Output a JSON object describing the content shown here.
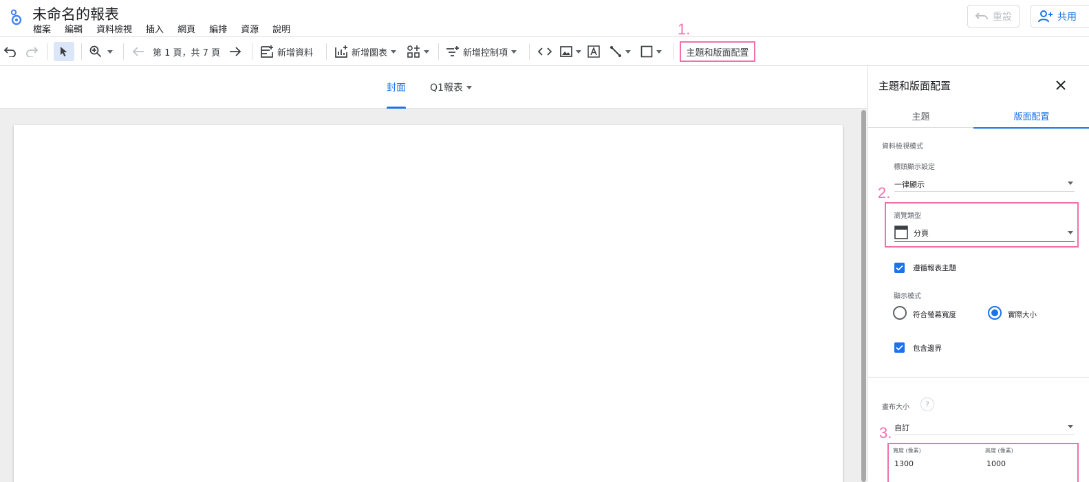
{
  "app": {
    "doc_title": "未命名的報表",
    "menu": [
      "檔案",
      "編輯",
      "資料檢視",
      "插入",
      "網頁",
      "編排",
      "資源",
      "說明"
    ],
    "reset_label": "重設",
    "share_label": "共用"
  },
  "annotations": {
    "label1": "1.",
    "label2": "2.",
    "label3": "3."
  },
  "toolbar": {
    "page_indicator": "第 1 頁，共 7 頁",
    "add_data_label": "新增資料",
    "add_chart_label": "新增圖表",
    "add_control_label": "新增控制項",
    "theme_layout_label": "主題和版面配置"
  },
  "page_tabs": [
    {
      "label": "封面",
      "active": true
    },
    {
      "label": "Q1報表",
      "active": false
    }
  ],
  "panel": {
    "title": "主題和版面配置",
    "tabs": [
      {
        "label": "主題",
        "active": false
      },
      {
        "label": "版面配置",
        "active": true
      }
    ],
    "view_mode_section": "資料檢視模式",
    "header_display_label": "標頭顯示設定",
    "header_display_value": "一律顯示",
    "navigation_type_label": "瀏覽類型",
    "navigation_type_value": "分頁",
    "follow_theme_label": "遵循報表主題",
    "follow_theme_checked": true,
    "display_mode_label": "顯示模式",
    "display_mode_options": [
      {
        "label": "符合螢幕寬度",
        "selected": false
      },
      {
        "label": "實際大小",
        "selected": true
      }
    ],
    "include_border_label": "包含邊界",
    "include_border_checked": true,
    "canvas_size_label": "畫布大小",
    "canvas_size_value": "自訂",
    "width_label": "寬度 (像素)",
    "width_value": "1300",
    "height_label": "高度 (像素)",
    "height_value": "1000"
  },
  "colors": {
    "accent": "#1a73e8",
    "annotation": "#f06fae",
    "canvas_bg": "#eeeeee"
  }
}
